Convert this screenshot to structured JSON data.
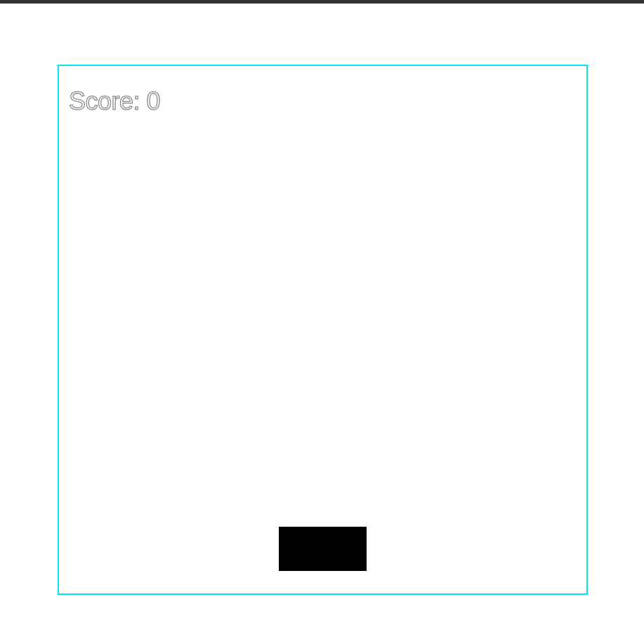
{
  "game": {
    "score_text": "Score: 0",
    "frame_color": "#00e5ee",
    "paddle_color": "#000000",
    "top_bar_color": "#333333"
  }
}
